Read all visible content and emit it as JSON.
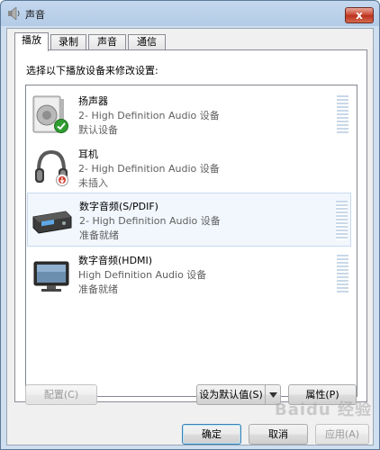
{
  "window": {
    "title": "声音",
    "close_label": "x"
  },
  "tabs": [
    {
      "label": "播放",
      "active": true
    },
    {
      "label": "录制",
      "active": false
    },
    {
      "label": "声音",
      "active": false
    },
    {
      "label": "通信",
      "active": false
    }
  ],
  "instruction": "选择以下播放设备来修改设置:",
  "devices": [
    {
      "name": "扬声器",
      "description": "2- High Definition Audio 设备",
      "status": "默认设备",
      "icon": "speaker-icon",
      "badge": "default-check-icon"
    },
    {
      "name": "耳机",
      "description": "2- High Definition Audio 设备",
      "status": "未插入",
      "icon": "headphones-icon",
      "badge": "unplugged-icon"
    },
    {
      "name": "数字音频(S/PDIF)",
      "description": "2- High Definition Audio 设备",
      "status": "准备就绪",
      "icon": "digital-audio-icon",
      "selected": true
    },
    {
      "name": "数字音频(HDMI)",
      "description": "High Definition Audio 设备",
      "status": "准备就绪",
      "icon": "monitor-icon"
    }
  ],
  "buttons": {
    "configure": "配置(C)",
    "set_default": "设为默认值(S)",
    "properties": "属性(P)",
    "ok": "确定",
    "cancel": "取消",
    "apply": "应用(A)"
  },
  "watermark": "Baidu 经验",
  "colors": {
    "accent_check": "#2f9d2f",
    "unplugged_badge": "#d23b2b",
    "selection": "#f2f7fd"
  }
}
